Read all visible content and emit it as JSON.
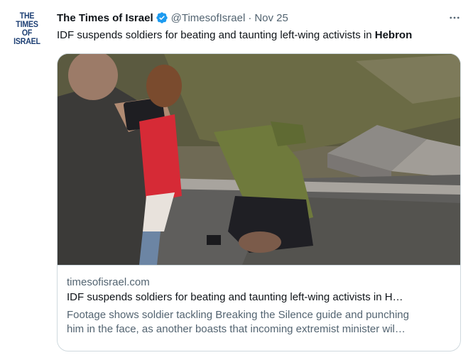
{
  "tweet": {
    "avatar_text": [
      "THE TIMES",
      "OF ISRAEL"
    ],
    "author_name": "The Times of Israel",
    "verified_icon": "verified-badge-icon",
    "handle": "@TimesofIsrael",
    "separator": "·",
    "date": "Nov 25",
    "more_icon": "more-options-icon",
    "text_prefix": "IDF suspends soldiers for beating and taunting left-wing activists in ",
    "text_bold": "Hebron"
  },
  "card": {
    "image_description_icon": "news-photo",
    "domain": "timesofisrael.com",
    "title": "IDF suspends soldiers for beating and taunting left-wing activists in H…",
    "description_line1": "Footage shows soldier tackling Breaking the Silence guide and punching",
    "description_line2": "him in the face, as another boasts that incoming extremist minister wil…"
  },
  "colors": {
    "text": "#0f1419",
    "secondary": "#536471",
    "verified": "#1d9bf0",
    "border": "#cfd9de",
    "logo": "#1d3f74"
  }
}
